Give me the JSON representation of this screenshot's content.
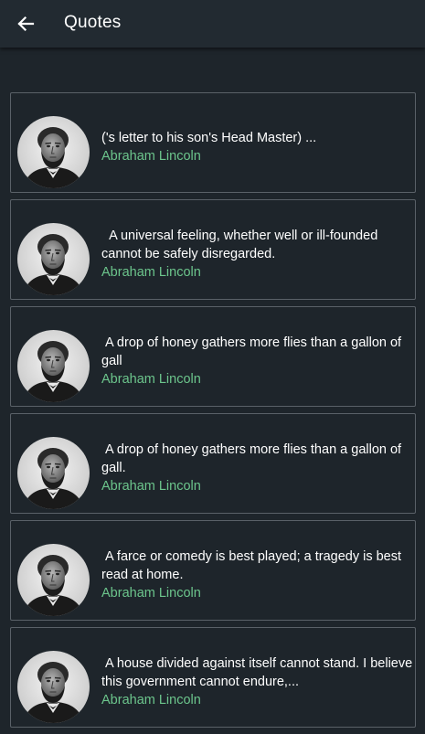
{
  "appbar": {
    "title": "Quotes",
    "back_icon": "arrow-left-icon"
  },
  "colors": {
    "background": "#1e252b",
    "appbar": "#222a31",
    "card_border": "#5a6168",
    "quote_text": "#ffffff",
    "author_text": "#6cc58c"
  },
  "quotes": [
    {
      "text": "('s letter to his son's Head Master) ...",
      "author": "Abraham Lincoln",
      "avatar": "abraham-lincoln-portrait"
    },
    {
      "text": "  A universal feeling, whether well or ill-founded cannot be safely disregarded.",
      "author": "Abraham Lincoln",
      "avatar": "abraham-lincoln-portrait"
    },
    {
      "text": " A drop of honey gathers more flies than a gallon of gall",
      "author": "Abraham Lincoln",
      "avatar": "abraham-lincoln-portrait"
    },
    {
      "text": " A drop of honey gathers more flies than a gallon of gall.",
      "author": "Abraham Lincoln",
      "avatar": "abraham-lincoln-portrait"
    },
    {
      "text": " A farce or comedy is best played; a tragedy is best read at home.",
      "author": "Abraham Lincoln",
      "avatar": "abraham-lincoln-portrait"
    },
    {
      "text": " A house divided against itself cannot stand. I believe this government cannot endure,...",
      "author": "Abraham Lincoln",
      "avatar": "abraham-lincoln-portrait"
    }
  ]
}
